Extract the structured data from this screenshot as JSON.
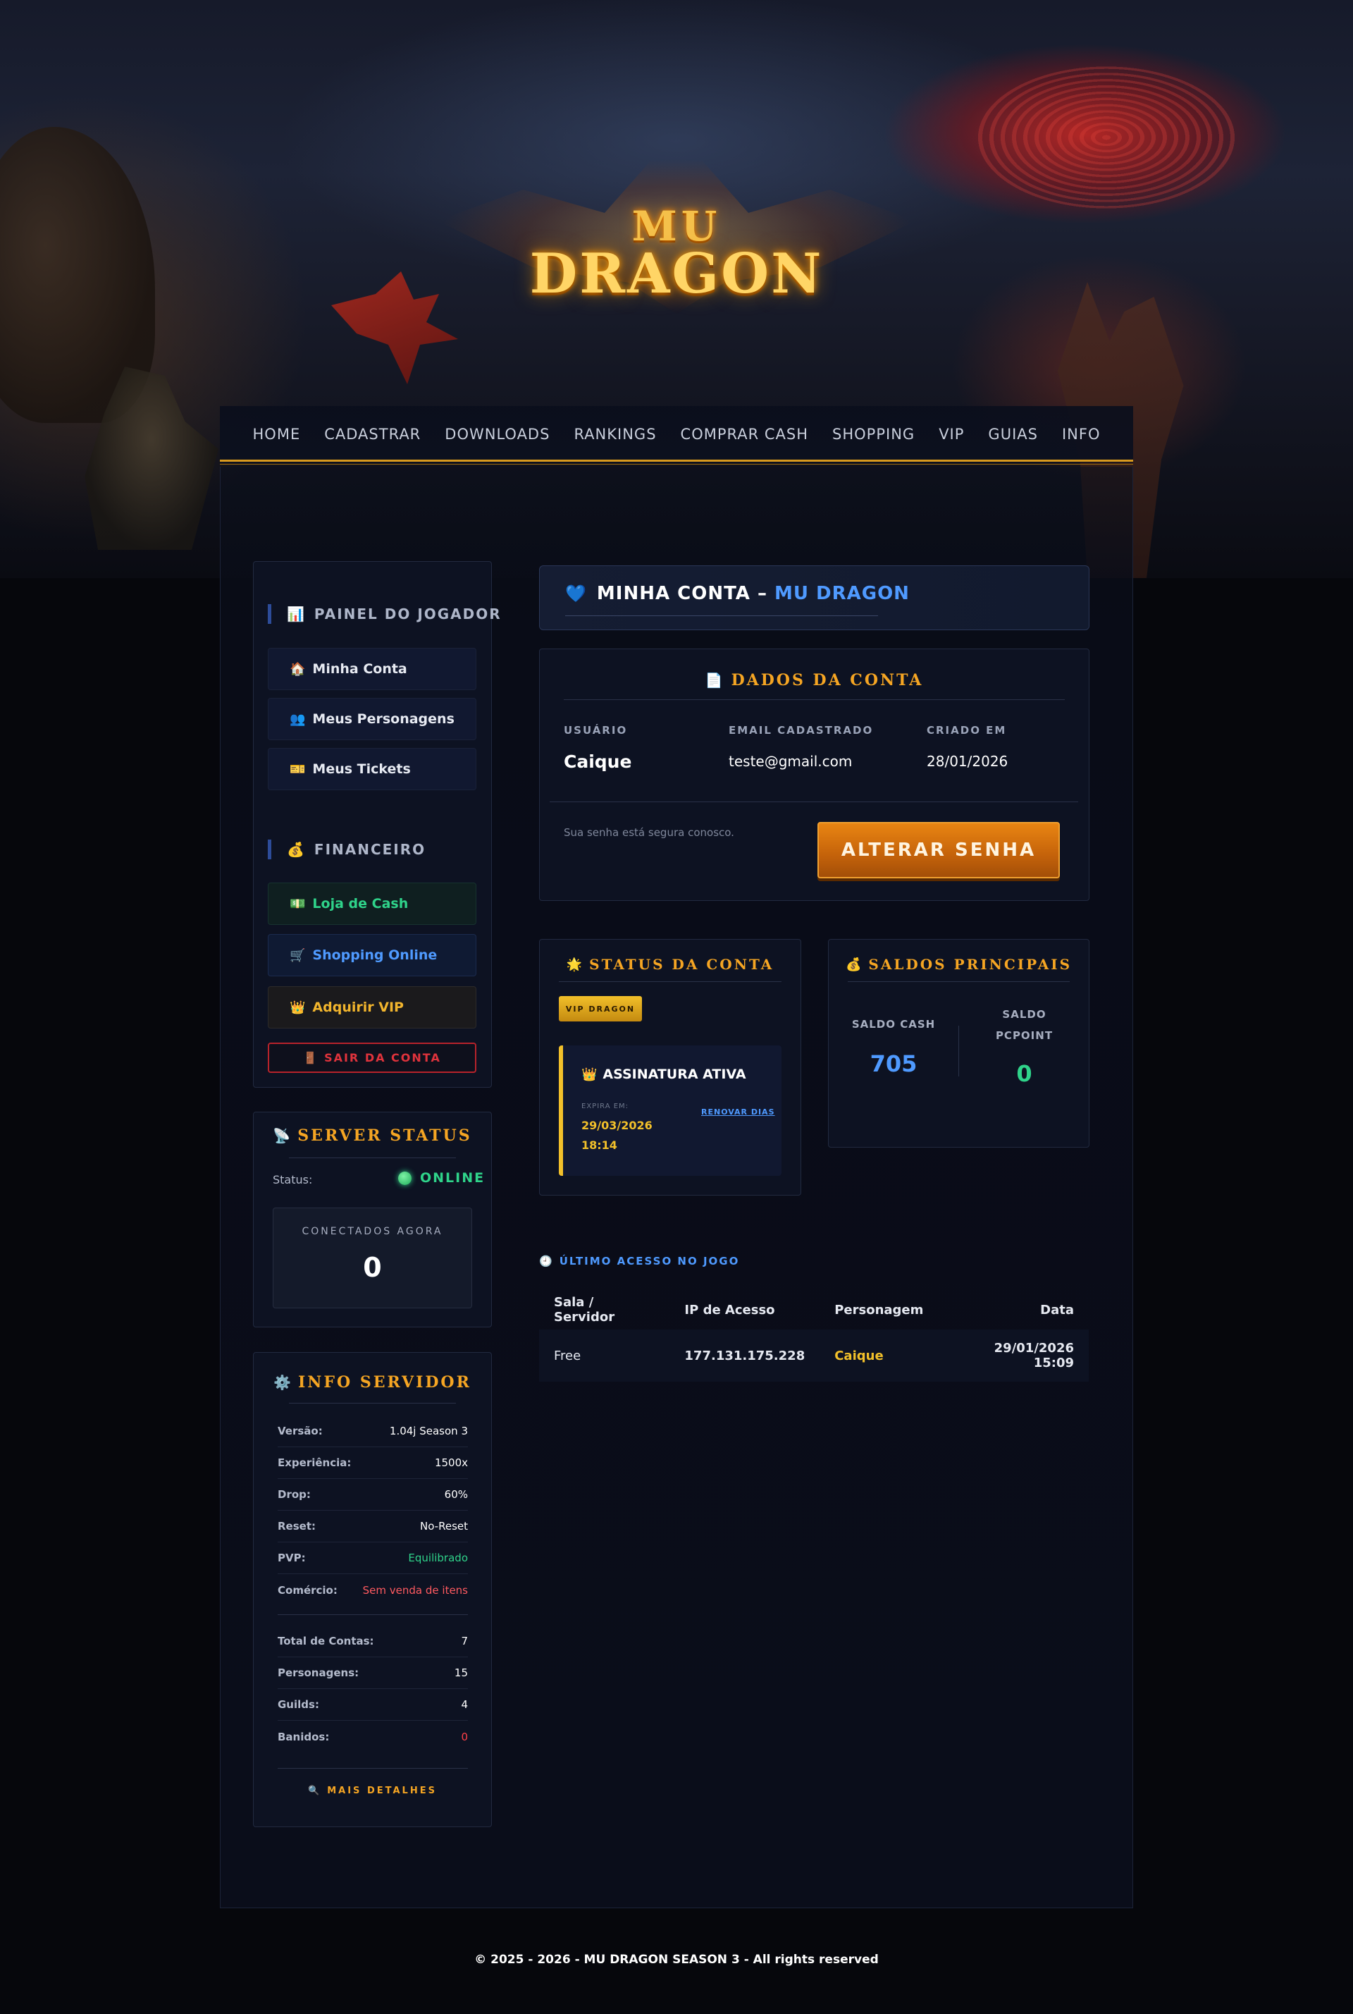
{
  "logo": {
    "line1": "MU",
    "line2": "DRAGON"
  },
  "nav": [
    "HOME",
    "CADASTRAR",
    "DOWNLOADS",
    "RANKINGS",
    "COMPRAR CASH",
    "SHOPPING",
    "VIP",
    "GUIAS",
    "INFO"
  ],
  "sidebar": {
    "painel": {
      "icon": "📊",
      "title": "PAINEL DO JOGADOR",
      "items": [
        {
          "icon": "🏠",
          "label": "Minha Conta"
        },
        {
          "icon": "👥",
          "label": "Meus Personagens"
        },
        {
          "icon": "🎫",
          "label": "Meus Tickets"
        }
      ]
    },
    "financeiro": {
      "icon": "💰",
      "title": "FINANCEIRO",
      "items": [
        {
          "icon": "💵",
          "label": "Loja de Cash"
        },
        {
          "icon": "🛒",
          "label": "Shopping Online"
        },
        {
          "icon": "👑",
          "label": "Adquirir VIP"
        }
      ],
      "logout": {
        "icon": "🚪",
        "label": "SAIR DA CONTA"
      }
    },
    "server_status": {
      "icon": "📡",
      "title": "SERVER STATUS",
      "status_label": "Status:",
      "status_value": "ONLINE",
      "connected_label": "CONECTADOS AGORA",
      "connected_value": "0"
    },
    "info_servidor": {
      "icon": "⚙️",
      "title": "INFO SERVIDOR",
      "rows": [
        {
          "k": "Versão:",
          "v": "1.04j Season 3"
        },
        {
          "k": "Experiência:",
          "v": "1500x"
        },
        {
          "k": "Drop:",
          "v": "60%"
        },
        {
          "k": "Reset:",
          "v": "No-Reset"
        },
        {
          "k": "PVP:",
          "v": "Equilibrado"
        },
        {
          "k": "Comércio:",
          "v": "Sem venda de itens"
        }
      ],
      "stats": [
        {
          "k": "Total de Contas:",
          "v": "7"
        },
        {
          "k": "Personagens:",
          "v": "15"
        },
        {
          "k": "Guilds:",
          "v": "4"
        },
        {
          "k": "Banidos:",
          "v": "0"
        }
      ],
      "more_icon": "🔍",
      "more": "MAIS DETALHES"
    }
  },
  "account": {
    "heart_icon": "💙",
    "title_prefix": "MINHA CONTA –",
    "title_suffix": "MU DRAGON",
    "dados": {
      "icon": "📄",
      "title": "DADOS DA CONTA",
      "usuario_label": "USUÁRIO",
      "usuario": "Caique",
      "email_label": "EMAIL CADASTRADO",
      "email": "teste@gmail.com",
      "criado_label": "CRIADO EM",
      "criado": "28/01/2026",
      "senha_note": "Sua senha está segura conosco.",
      "alterar": "ALTERAR SENHA"
    },
    "status": {
      "icon": "🌟",
      "title": "STATUS DA CONTA",
      "badge": "VIP DRAGON",
      "crown_icon": "👑",
      "assinatura": "ASSINATURA ATIVA",
      "expira_label": "EXPIRA EM:",
      "expira_date": "29/03/2026",
      "expira_time": "18:14",
      "renovar": "RENOVAR DIAS"
    },
    "saldos": {
      "icon": "💰",
      "title": "SALDOS PRINCIPAIS",
      "cash_label": "SALDO CASH",
      "cash": "705",
      "pcpoint_label_1": "SALDO",
      "pcpoint_label_2": "PCPOINT",
      "pcpoint": "0"
    },
    "ultimo": {
      "icon": "🕘",
      "title": "ÚLTIMO ACESSO NO JOGO",
      "headers": [
        "Sala / Servidor",
        "IP de Acesso",
        "Personagem",
        "Data"
      ],
      "row": [
        "Free",
        "177.131.175.228",
        "Caique",
        "29/01/2026 15:09"
      ]
    }
  },
  "footer": "© 2025 - 2026 - MU DRAGON SEASON 3 - All rights reserved",
  "colors": {
    "gold": "#f5a523",
    "blue": "#4f9aff",
    "green": "#2fd38a",
    "red": "#e0333c",
    "yellow": "#f2c02a"
  }
}
